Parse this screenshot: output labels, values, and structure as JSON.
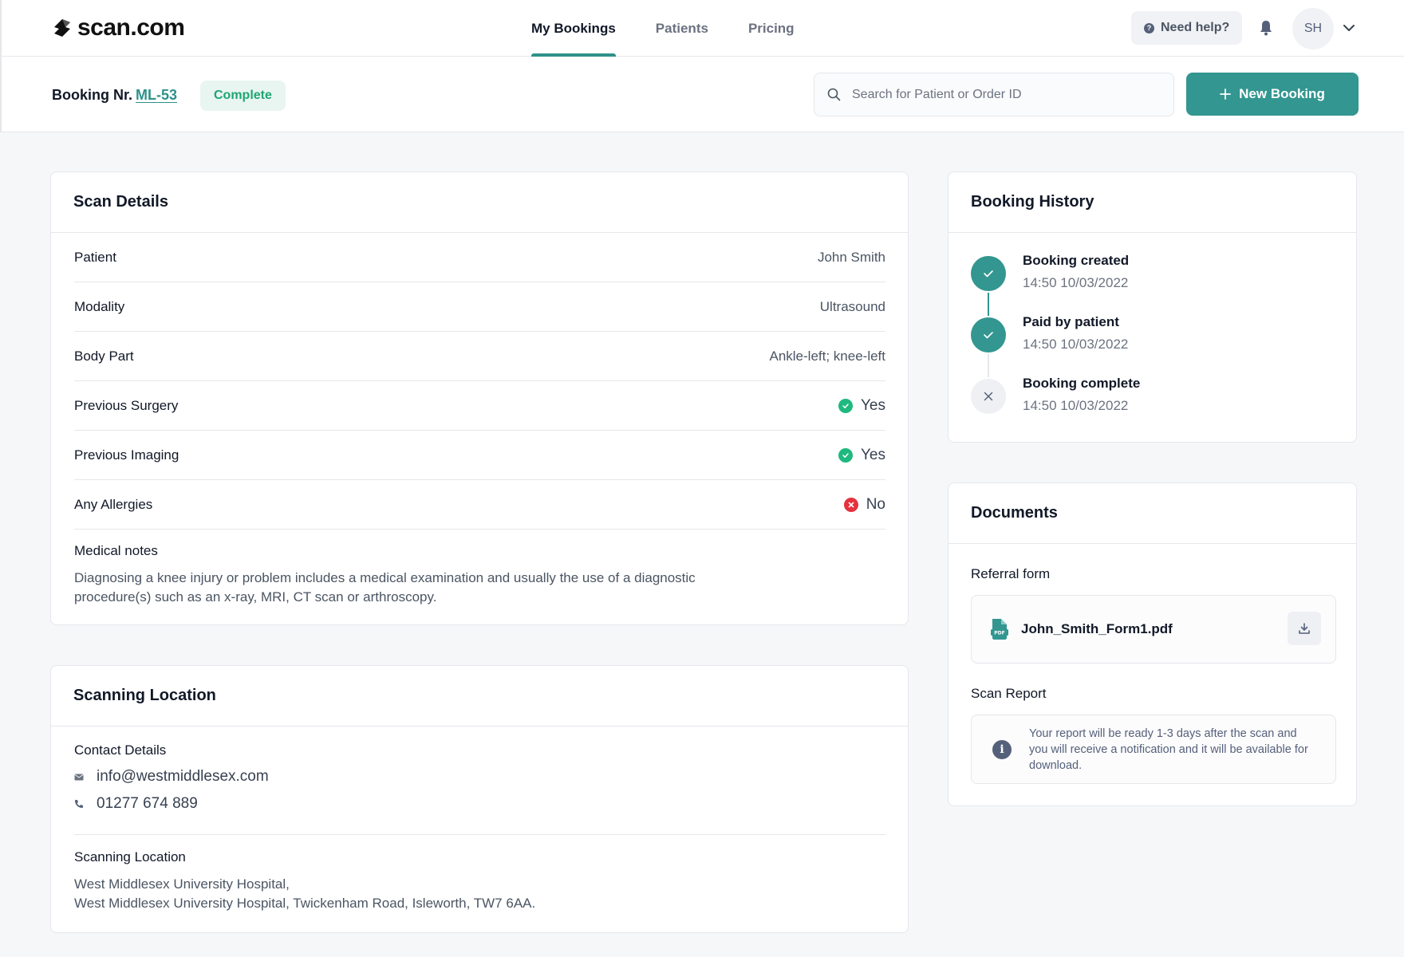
{
  "header": {
    "logo_text": "scan.com",
    "nav": [
      {
        "label": "My Bookings",
        "active": true
      },
      {
        "label": "Patients",
        "active": false
      },
      {
        "label": "Pricing",
        "active": false
      }
    ],
    "help_label": "Need help?",
    "avatar_initials": "SH"
  },
  "subheader": {
    "booking_label": "Booking Nr.",
    "booking_id": "ML-53",
    "status": "Complete",
    "search_placeholder": "Search for Patient or Order ID",
    "new_booking_label": "New Booking"
  },
  "scan_details": {
    "title": "Scan Details",
    "rows": [
      {
        "label": "Patient",
        "value": "John Smith"
      },
      {
        "label": "Modality",
        "value": "Ultrasound"
      },
      {
        "label": "Body Part",
        "value": "Ankle-left; knee-left"
      },
      {
        "label": "Previous Surgery",
        "value": "Yes",
        "status": "yes"
      },
      {
        "label": "Previous Imaging",
        "value": "Yes",
        "status": "yes"
      },
      {
        "label": "Any Allergies",
        "value": "No",
        "status": "no"
      }
    ],
    "notes_label": "Medical notes",
    "notes_text": "Diagnosing a knee injury or problem includes a medical examination and usually the use of a diagnostic procedure(s) such as an x-ray, MRI, CT scan or arthroscopy."
  },
  "scanning_location": {
    "title": "Scanning Location",
    "contact_label": "Contact Details",
    "email": "info@westmiddlesex.com",
    "phone": "01277 674 889",
    "location_label": "Scanning Location",
    "address_line1": "West Middlesex University Hospital,",
    "address_line2": "West Middlesex University Hospital, Twickenham Road, Isleworth, TW7 6AA."
  },
  "booking_history": {
    "title": "Booking History",
    "events": [
      {
        "title": "Booking created",
        "time": "14:50 10/03/2022",
        "done": true
      },
      {
        "title": "Paid by patient",
        "time": "14:50 10/03/2022",
        "done": true
      },
      {
        "title": "Booking complete",
        "time": "14:50 10/03/2022",
        "done": false
      }
    ]
  },
  "documents": {
    "title": "Documents",
    "referral_label": "Referral form",
    "referral_file": "John_Smith_Form1.pdf",
    "report_label": "Scan Report",
    "report_info": "Your report will be ready 1-3 days after the scan and you will receive a notification and it will be available for download."
  },
  "colors": {
    "accent": "#339690",
    "success": "#1fb97f",
    "error": "#e5323f",
    "badge_bg": "#e8f5f1",
    "badge_text": "#1fa574"
  }
}
